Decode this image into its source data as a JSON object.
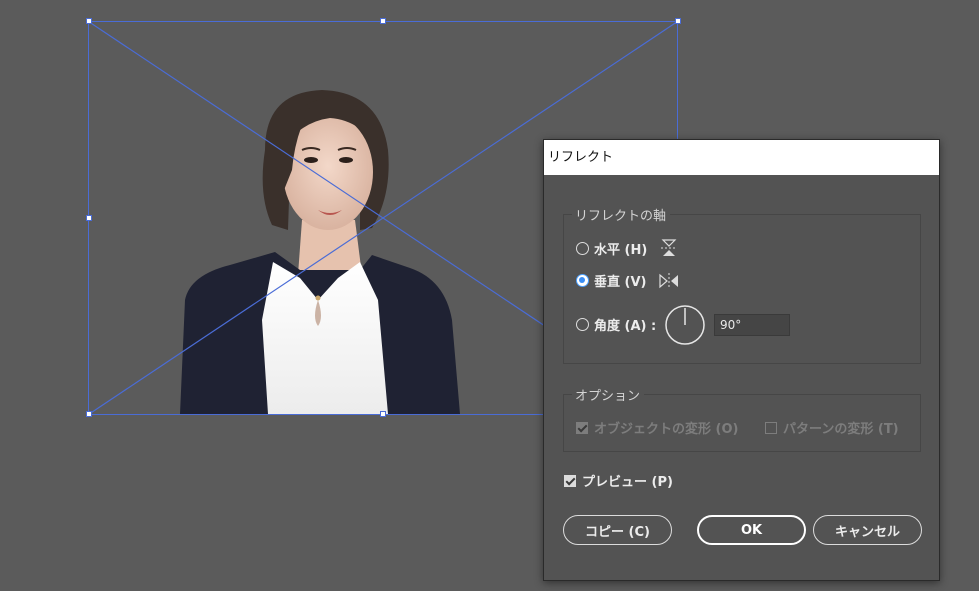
{
  "dialog": {
    "title": "リフレクト",
    "axis_group": {
      "title": "リフレクトの軸",
      "options": [
        {
          "label": "水平 (H)",
          "selected": false,
          "icon": "flip-horizontal-axis-icon"
        },
        {
          "label": "垂直 (V)",
          "selected": true,
          "icon": "flip-vertical-axis-icon"
        },
        {
          "label": "角度 (A) :",
          "selected": false,
          "icon": "angle-dial-icon"
        }
      ],
      "angle_value": "90°"
    },
    "options_group": {
      "title": "オプション",
      "transform_objects": {
        "label": "オブジェクトの変形 (O)",
        "checked": true,
        "enabled": false
      },
      "transform_patterns": {
        "label": "パターンの変形 (T)",
        "checked": false,
        "enabled": false
      }
    },
    "preview": {
      "label": "プレビュー (P)",
      "checked": true
    },
    "buttons": {
      "copy": "コピー (C)",
      "ok": "OK",
      "cancel": "キャンセル"
    }
  },
  "canvas": {
    "image_placeholder": "placed-image-frame",
    "colors": {
      "background": "#5b5b5b",
      "selection": "#4a6cd6",
      "accent": "#3a8ef5"
    }
  }
}
